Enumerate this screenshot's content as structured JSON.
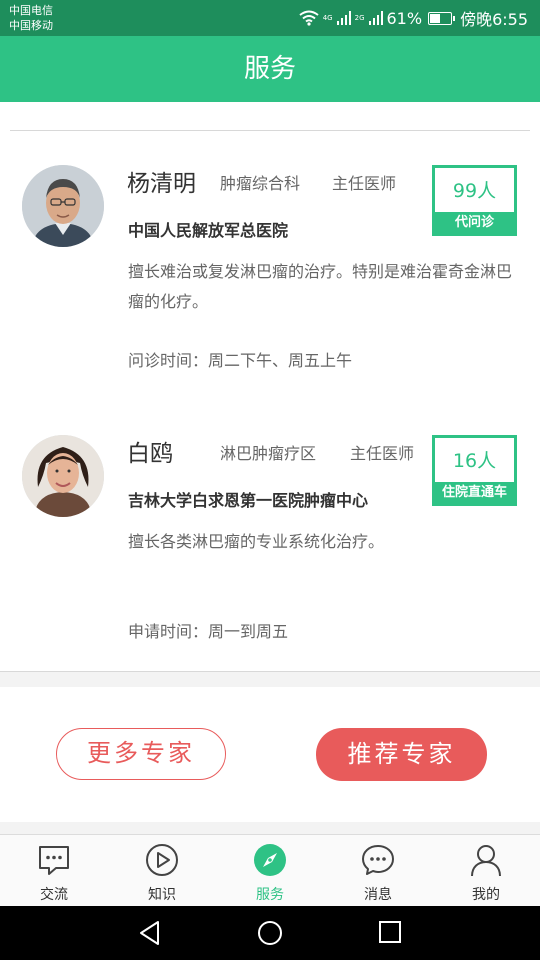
{
  "status_bar": {
    "carrier_1": "中国电信",
    "carrier_2": "中国移动",
    "net_label_1": "4G",
    "net_label_2": "2G",
    "battery_level_percent": 61,
    "battery_text": "61%",
    "time": "傍晚6:55"
  },
  "header": {
    "title": "服务"
  },
  "doctors": [
    {
      "name": "杨清明",
      "department": "肿瘤综合科",
      "title": "主任医师",
      "hospital": "中国人民解放军总医院",
      "intro": "擅长难治或复发淋巴瘤的治疗。特别是难治霍奇金淋巴瘤的化疗。",
      "time": "问诊时间：周二下午、周五上午",
      "stat_count": "99人",
      "stat_label": "代问诊"
    },
    {
      "name": "白鸥",
      "department": "淋巴肿瘤疗区",
      "title": "主任医师",
      "hospital": "吉林大学白求恩第一医院肿瘤中心",
      "intro": "擅长各类淋巴瘤的专业系统化治疗。",
      "time": "申请时间：周一到周五",
      "stat_count": "16人",
      "stat_label": "住院直通车"
    }
  ],
  "actions": {
    "more_label": "更多专家",
    "recommend_label": "推荐专家"
  },
  "bottom_nav": {
    "items": [
      {
        "label": "交流",
        "icon": "chat-bubble-icon"
      },
      {
        "label": "知识",
        "icon": "play-icon"
      },
      {
        "label": "服务",
        "icon": "compass-icon",
        "active": true
      },
      {
        "label": "消息",
        "icon": "message-icon"
      },
      {
        "label": "我的",
        "icon": "user-icon"
      }
    ]
  },
  "colors": {
    "header": "#2ec285",
    "status_bar": "#1e8e5c",
    "accent_red": "#e85b5b"
  }
}
